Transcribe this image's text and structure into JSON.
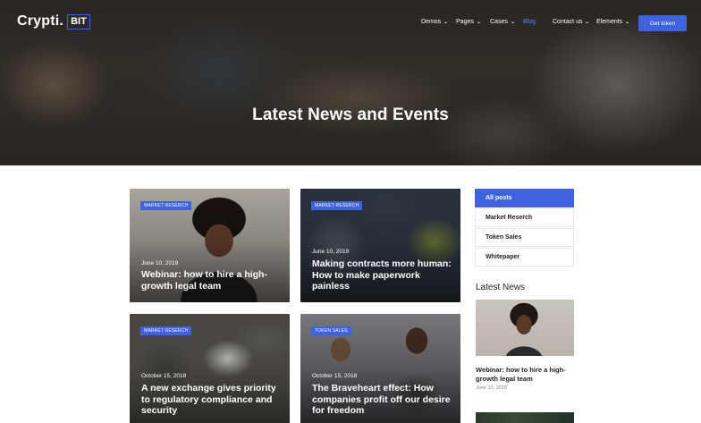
{
  "header": {
    "logo_text": "Crypti.",
    "logo_box": "BIT",
    "nav": [
      {
        "label": "Demos",
        "dropdown": true,
        "active": false
      },
      {
        "label": "Pages",
        "dropdown": true,
        "active": false
      },
      {
        "label": "Cases",
        "dropdown": true,
        "active": false
      },
      {
        "label": "Blog",
        "dropdown": false,
        "active": true
      },
      {
        "label": "Contact us",
        "dropdown": true,
        "active": false
      },
      {
        "label": "Elements",
        "dropdown": true,
        "active": false
      }
    ],
    "cta": "Get token"
  },
  "hero": {
    "title": "Latest News and Events"
  },
  "posts": [
    {
      "category": "MARKET RESERCH",
      "date": "June 10, 2019",
      "title": "Webinar: how to hire a high-growth legal team"
    },
    {
      "category": "MARKET RESERCH",
      "date": "June 10, 2019",
      "title": "Making contracts more human: How to make paperwork painless"
    },
    {
      "category": "MARKET RESERCH",
      "date": "October 15, 2018",
      "title": "A new exchange gives priority to regulatory compliance and security"
    },
    {
      "category": "TOKEN SALES",
      "date": "October 15, 2018",
      "title": "The Braveheart effect: How companies profit off our desire for freedom"
    }
  ],
  "sidebar": {
    "categories": [
      {
        "label": "All posts",
        "active": true
      },
      {
        "label": "Market Reserch",
        "active": false
      },
      {
        "label": "Token Sales",
        "active": false
      },
      {
        "label": "Whitepaper",
        "active": false
      }
    ],
    "latest_heading": "Latest News",
    "latest_post": {
      "title": "Webinar: how to hire a high-growth legal team",
      "date": "June 10, 2019"
    }
  },
  "colors": {
    "accent": "#3f63e0",
    "active_nav": "#5a86ff"
  }
}
